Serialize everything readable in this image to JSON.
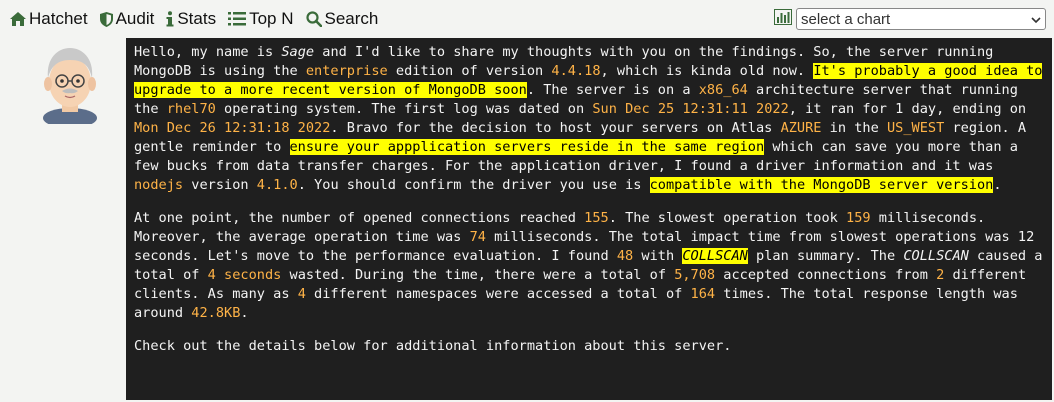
{
  "nav": {
    "hatchet": "Hatchet",
    "audit": "Audit",
    "stats": "Stats",
    "topn": "Top N",
    "search": "Search"
  },
  "chart_select": {
    "selected": "select a chart"
  },
  "summary": {
    "p1": {
      "t1": "Hello, my name is ",
      "name": "Sage",
      "t2": " and I'd like to share my thoughts with you on the findings. So, the server running MongoDB is using the ",
      "edition": "enterprise",
      "t3": " edition of version ",
      "version": "4.4.18",
      "t4": ", which is kinda old now. ",
      "upgrade_note": "It's probably a good idea to upgrade to a more recent version of MongoDB soon",
      "t5": ". The server is on a ",
      "arch": "x86_64",
      "t6": " architecture server that running the ",
      "os": "rhel70",
      "t7": " operating system. The first log was dated on ",
      "first_log": "Sun Dec 25 12:31:11 2022",
      "t8": ", it ran for 1 day, ending on ",
      "last_log": "Mon Dec 26 12:31:18 2022",
      "t9": ". Bravo for the decision to host your servers on Atlas ",
      "provider": "AZURE",
      "t10": " in the ",
      "region": "US_WEST",
      "t11": " region. A gentle reminder to ",
      "region_note": "ensure your appplication servers reside in the same region",
      "t12": " which can save you more than a few bucks from data transfer charges. For the application driver, I found a driver information and it was ",
      "driver": "nodejs",
      "t13": " version ",
      "driver_version": "4.1.0",
      "t14": ". You should confirm the driver you use is ",
      "compat_note": "compatible with the MongoDB server version",
      "t15": "."
    },
    "p2": {
      "t1": "At one point, the number of opened connections reached ",
      "max_conns": "155",
      "t2": ". The slowest operation took ",
      "slowest_ms": "159",
      "t3": " milliseconds. Moreover, the average operation time was ",
      "avg_ms": "74",
      "t4": " milliseconds. The total impact time from slowest operations was 12 seconds. Let's move to the performance evaluation. I found ",
      "collscan_count": "48",
      "t5": " with ",
      "collscan_label": "COLLSCAN",
      "t6": " plan summary. The ",
      "collscan_label2": "COLLSCAN",
      "t7": " caused a total of ",
      "wasted": "4 seconds",
      "t8": " wasted. During the time, there were a total of ",
      "accepted": "5,708",
      "t9": " accepted connections from ",
      "clients": "2",
      "t10": " different clients. As many as ",
      "namespaces": "4",
      "t11": " different namespaces were accessed a total of ",
      "times": "164",
      "t12": " times. The total response length was around ",
      "resp_len": "42.8KB",
      "t13": "."
    },
    "p3": "Check out the details below for additional information about this server."
  },
  "colors": {
    "panel_bg": "#1f1f1f",
    "highlight_text": "#ffb347",
    "marker_bg": "#ffff00"
  }
}
